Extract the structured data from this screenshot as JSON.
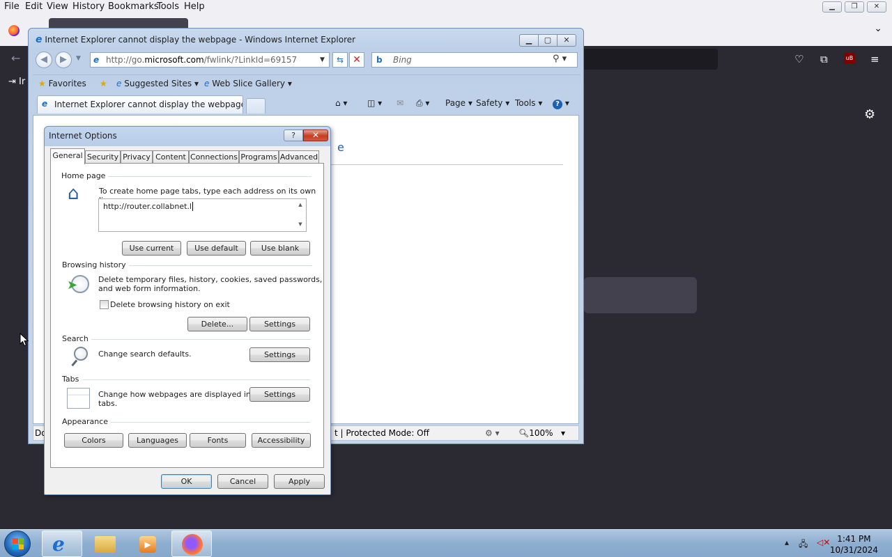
{
  "firefox": {
    "menu": [
      "File",
      "Edit",
      "View",
      "History",
      "Bookmarks",
      "Tools",
      "Help"
    ],
    "import_label": "Ir"
  },
  "ie": {
    "title": "Internet Explorer cannot display the webpage - Windows Internet Explorer",
    "address_prefix": "http://go.",
    "address_domain": "microsoft.com",
    "address_suffix": "/fwlink/?LinkId=69157",
    "search_placeholder": "Bing",
    "favorites_label": "Favorites",
    "suggested_sites": "Suggested Sites",
    "web_slice_gallery": "Web Slice Gallery",
    "tab_title": "Internet Explorer cannot display the webpage",
    "commands": {
      "page": "Page",
      "safety": "Safety",
      "tools": "Tools"
    },
    "heading_fragment": "e",
    "status_left": "Do",
    "status_mode": "t | Protected Mode: Off",
    "zoom": "100%"
  },
  "dialog": {
    "title": "Internet Options",
    "tabs": [
      "General",
      "Security",
      "Privacy",
      "Content",
      "Connections",
      "Programs",
      "Advanced"
    ],
    "home_page": {
      "label": "Home page",
      "description": "To create home page tabs, type each address on its own line.",
      "value": "http://router.collabnet.l",
      "use_current": "Use current",
      "use_default": "Use default",
      "use_blank": "Use blank"
    },
    "browsing_history": {
      "label": "Browsing history",
      "description_line1": "Delete temporary files, history, cookies, saved passwords,",
      "description_line2": "and web form information.",
      "checkbox_label": "Delete browsing history on exit",
      "delete_button": "Delete...",
      "settings_button": "Settings"
    },
    "search": {
      "label": "Search",
      "description": "Change search defaults.",
      "settings_button": "Settings"
    },
    "tabs_section": {
      "label": "Tabs",
      "description_line1": "Change how webpages are displayed in",
      "description_line2": "tabs.",
      "settings_button": "Settings"
    },
    "appearance": {
      "label": "Appearance",
      "colors": "Colors",
      "languages": "Languages",
      "fonts": "Fonts",
      "accessibility": "Accessibility"
    },
    "ok": "OK",
    "cancel": "Cancel",
    "apply": "Apply"
  },
  "taskbar": {
    "time": "1:41 PM",
    "date": "10/31/2024"
  }
}
